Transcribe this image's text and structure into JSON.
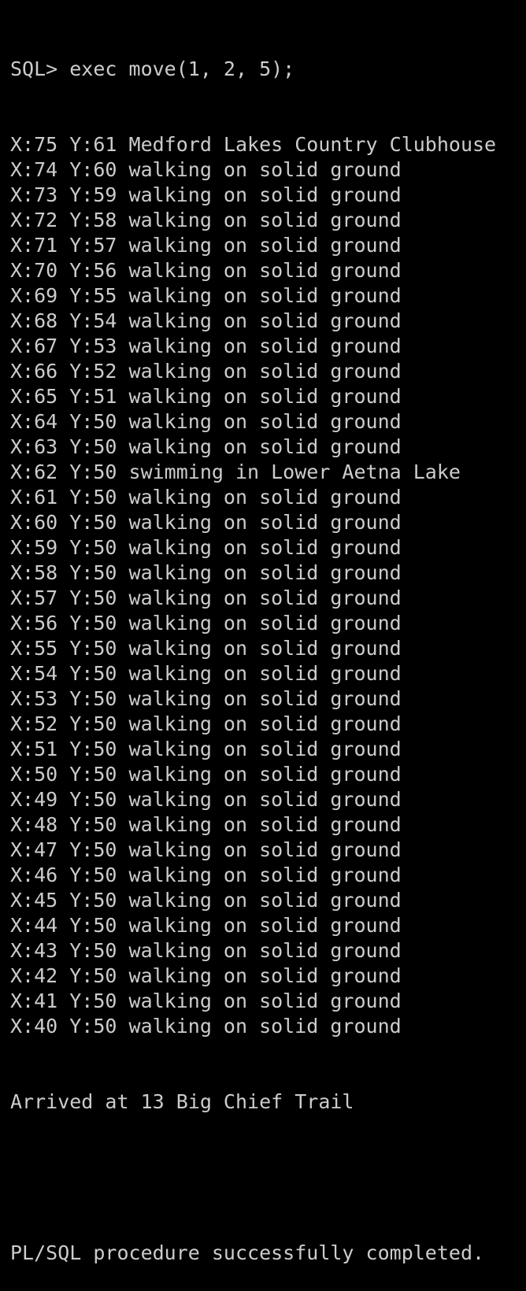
{
  "colors": {
    "background": "#000000",
    "text": "#cccccc"
  },
  "console": {
    "command": "SQL> exec move(1, 2, 5);",
    "lines": [
      "X:75 Y:61 Medford Lakes Country Clubhouse",
      "X:74 Y:60 walking on solid ground",
      "X:73 Y:59 walking on solid ground",
      "X:72 Y:58 walking on solid ground",
      "X:71 Y:57 walking on solid ground",
      "X:70 Y:56 walking on solid ground",
      "X:69 Y:55 walking on solid ground",
      "X:68 Y:54 walking on solid ground",
      "X:67 Y:53 walking on solid ground",
      "X:66 Y:52 walking on solid ground",
      "X:65 Y:51 walking on solid ground",
      "X:64 Y:50 walking on solid ground",
      "X:63 Y:50 walking on solid ground",
      "X:62 Y:50 swimming in Lower Aetna Lake",
      "X:61 Y:50 walking on solid ground",
      "X:60 Y:50 walking on solid ground",
      "X:59 Y:50 walking on solid ground",
      "X:58 Y:50 walking on solid ground",
      "X:57 Y:50 walking on solid ground",
      "X:56 Y:50 walking on solid ground",
      "X:55 Y:50 walking on solid ground",
      "X:54 Y:50 walking on solid ground",
      "X:53 Y:50 walking on solid ground",
      "X:52 Y:50 walking on solid ground",
      "X:51 Y:50 walking on solid ground",
      "X:50 Y:50 walking on solid ground",
      "X:49 Y:50 walking on solid ground",
      "X:48 Y:50 walking on solid ground",
      "X:47 Y:50 walking on solid ground",
      "X:46 Y:50 walking on solid ground",
      "X:45 Y:50 walking on solid ground",
      "X:44 Y:50 walking on solid ground",
      "X:43 Y:50 walking on solid ground",
      "X:42 Y:50 walking on solid ground",
      "X:41 Y:50 walking on solid ground",
      "X:40 Y:50 walking on solid ground"
    ],
    "arrival": "Arrived at 13 Big Chief Trail",
    "completion": "PL/SQL procedure successfully completed."
  }
}
